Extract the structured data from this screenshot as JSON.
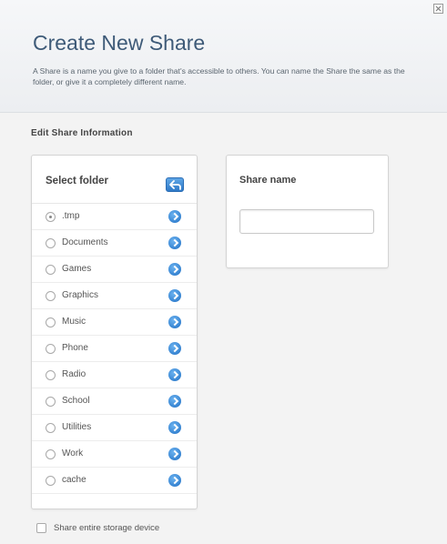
{
  "dialog": {
    "title": "Create New Share",
    "description": "A Share is a name you give to a folder that's accessible to others. You can name the Share the same as the folder, or give it a completely different name.",
    "close_icon": "close-icon"
  },
  "section": {
    "title": "Edit Share Information"
  },
  "folder_panel": {
    "header_label": "Select folder",
    "back_icon": "back-arrow-icon",
    "folders": [
      {
        "name": ".tmp",
        "selected": true
      },
      {
        "name": "Documents",
        "selected": false
      },
      {
        "name": "Games",
        "selected": false
      },
      {
        "name": "Graphics",
        "selected": false
      },
      {
        "name": "Music",
        "selected": false
      },
      {
        "name": "Phone",
        "selected": false
      },
      {
        "name": "Radio",
        "selected": false
      },
      {
        "name": "School",
        "selected": false
      },
      {
        "name": "Utilities",
        "selected": false
      },
      {
        "name": "Work",
        "selected": false
      },
      {
        "name": "cache",
        "selected": false
      }
    ],
    "open_icon": "chevron-right-icon"
  },
  "share_panel": {
    "label": "Share name",
    "value": "",
    "placeholder": ""
  },
  "footer": {
    "checkbox_label": "Share entire storage device",
    "checked": false
  },
  "colors": {
    "title": "#3e5a78",
    "accent_blue": "#2f79c7"
  }
}
